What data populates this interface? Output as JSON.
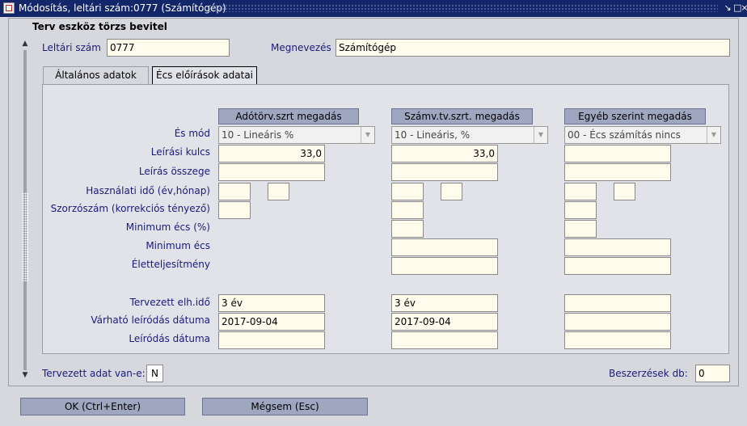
{
  "window": {
    "title": "Módosítás, leltári szám:0777 (Számítógép)"
  },
  "form": {
    "title": "Terv eszköz törzs bevitel"
  },
  "header": {
    "leltari_label": "Leltári szám",
    "leltari_value": "0777",
    "megnevezes_label": "Megnevezés",
    "megnevezes_value": "Számítógép"
  },
  "tabs": [
    {
      "label": "Általános adatok"
    },
    {
      "label": "Écs előírások adatai"
    }
  ],
  "columns": [
    {
      "header": "Adótörv.szrt megadás"
    },
    {
      "header": "Számv.tv.szrt. megadás"
    },
    {
      "header": "Egyéb szerint megadás"
    }
  ],
  "rows": {
    "es_mod": "És mód",
    "leirasi_kulcs": "Leírási kulcs",
    "leiras_osszege": "Leírás összege",
    "hasznalati_ido": "Használati idő (év,hónap)",
    "szorzoszam": "Szorzószám (korrekciós tényező)",
    "minimum_ecs_pct": "Minimum écs (%)",
    "minimum_ecs": "Minimum écs",
    "eletteljesitmeny": "Életteljesítmény",
    "tervezett_elh": "Tervezett elh.idő",
    "varhato_datum": "Várható leíródás dátuma",
    "leirodas_datum": "Leíródás dátuma"
  },
  "values": {
    "col1": {
      "es_mod": "10 - Lineáris %",
      "leirasi_kulcs": "33,0",
      "tervezett_elh": "3 év",
      "varhato_datum": "2017-09-04"
    },
    "col2": {
      "es_mod": "10 - Lineáris, %",
      "leirasi_kulcs": "33,0",
      "tervezett_elh": "3 év",
      "varhato_datum": "2017-09-04"
    },
    "col3": {
      "es_mod": "00 - Écs számítás nincs"
    }
  },
  "footer": {
    "tervezett_label": "Tervezett adat van-e:",
    "tervezett_value": "N",
    "beszerzesek_label": "Beszerzések db:",
    "beszerzesek_value": "0"
  },
  "buttons": {
    "ok": "OK (Ctrl+Enter)",
    "cancel": "Mégsem (Esc)"
  },
  "icons": {
    "window_icon": "app-window-icon",
    "minimize": "minimize-icon",
    "maximize": "maximize-icon",
    "close": "close-icon"
  }
}
